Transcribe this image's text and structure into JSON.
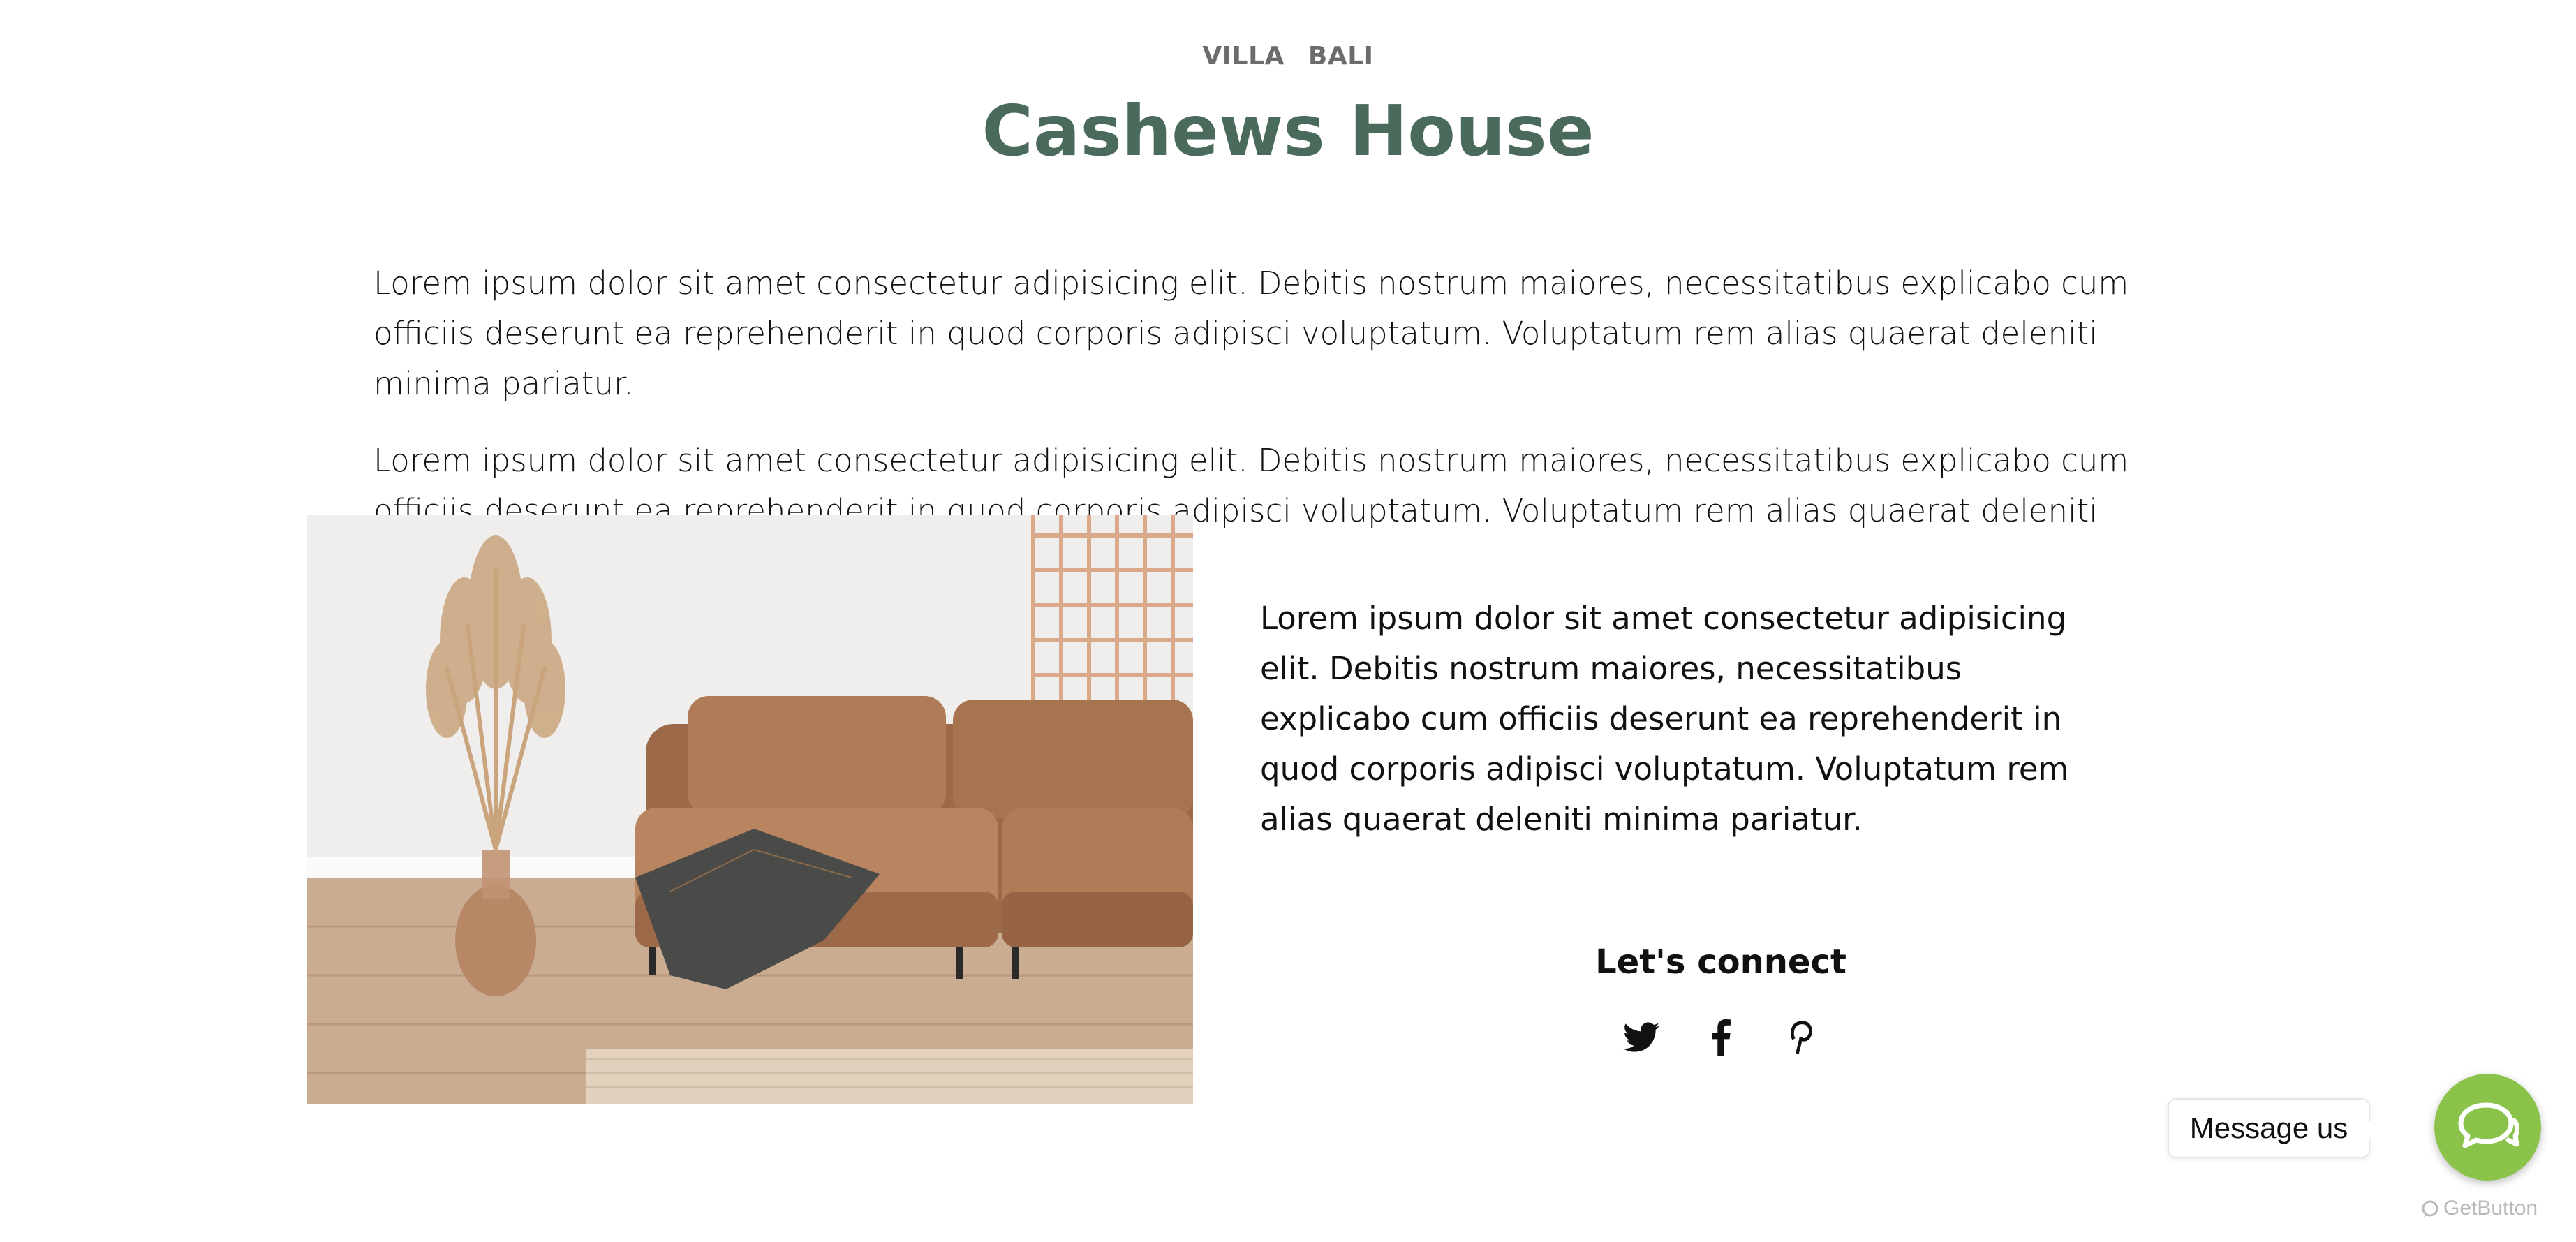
{
  "header": {
    "tags": [
      "VILLA",
      "BALI"
    ],
    "title": "Cashews House"
  },
  "intro": {
    "paragraphs": [
      "Lorem ipsum dolor sit amet consectetur adipisicing elit. Debitis nostrum maiores, necessitatibus explicabo cum officiis deserunt ea reprehenderit in quod corporis adipisci voluptatum. Voluptatum rem alias quaerat deleniti minima pariatur.",
      "Lorem ipsum dolor sit amet consectetur adipisicing elit. Debitis nostrum maiores, necessitatibus explicabo cum officiis deserunt ea reprehenderit in quod corporis adipisci voluptatum. Voluptatum rem alias quaerat deleniti minima pariatur."
    ]
  },
  "side": {
    "text": "Lorem ipsum dolor sit amet consectetur adipisicing elit. Debitis nostrum maiores, necessitatibus explicabo cum officiis deserunt ea reprehenderit in quod corporis adipisci voluptatum. Voluptatum rem alias quaerat deleniti minima pariatur."
  },
  "connect": {
    "title": "Let's connect",
    "socials": [
      {
        "icon": "twitter-icon"
      },
      {
        "icon": "facebook-icon"
      },
      {
        "icon": "pinterest-icon"
      }
    ]
  },
  "widget": {
    "message_label": "Message us",
    "brand": "GetButton",
    "button_color": "#8bc34a"
  },
  "colors": {
    "title": "#4a6a5b",
    "tags": "#6c6c6c",
    "text": "#111111"
  }
}
